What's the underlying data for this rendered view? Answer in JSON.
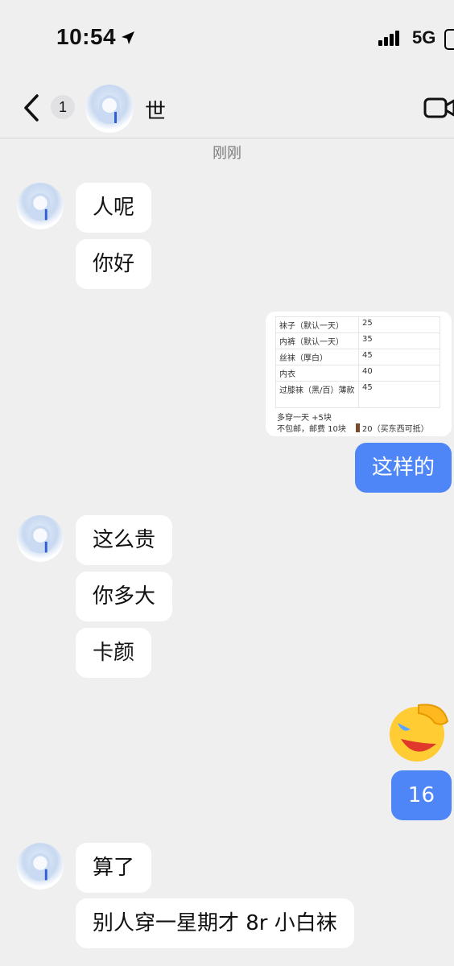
{
  "status_bar": {
    "time": "10:54",
    "network": "5G"
  },
  "header": {
    "unread_count": "1",
    "contact_name": "世"
  },
  "timestamp": "刚刚",
  "messages": {
    "m1": "人呢",
    "m2": "你好",
    "m3": "这样的",
    "m4": "这么贵",
    "m5": "你多大",
    "m6": "卡颜",
    "m7": "16",
    "m8": "算了",
    "m9": "别人穿一星期才 8r 小白袜"
  },
  "price_card": {
    "rows": [
      {
        "item": "袜子（默认一天）",
        "price": "25"
      },
      {
        "item": "内裤（默认一天）",
        "price": "35"
      },
      {
        "item": "丝袜（厚白）",
        "price": "45"
      },
      {
        "item": "内衣",
        "price": "40"
      },
      {
        "item": "过膝袜（黑/百）薄款",
        "price": "45"
      }
    ],
    "note1": "多穿一天 +5块",
    "note2": "不包邮，邮费 10块",
    "note3": "20（买东西可抵）"
  },
  "icons": [
    "location-arrow-icon",
    "signal-icon",
    "battery-icon",
    "back-chevron-icon",
    "video-call-icon",
    "facepalm-laugh-emoji"
  ]
}
